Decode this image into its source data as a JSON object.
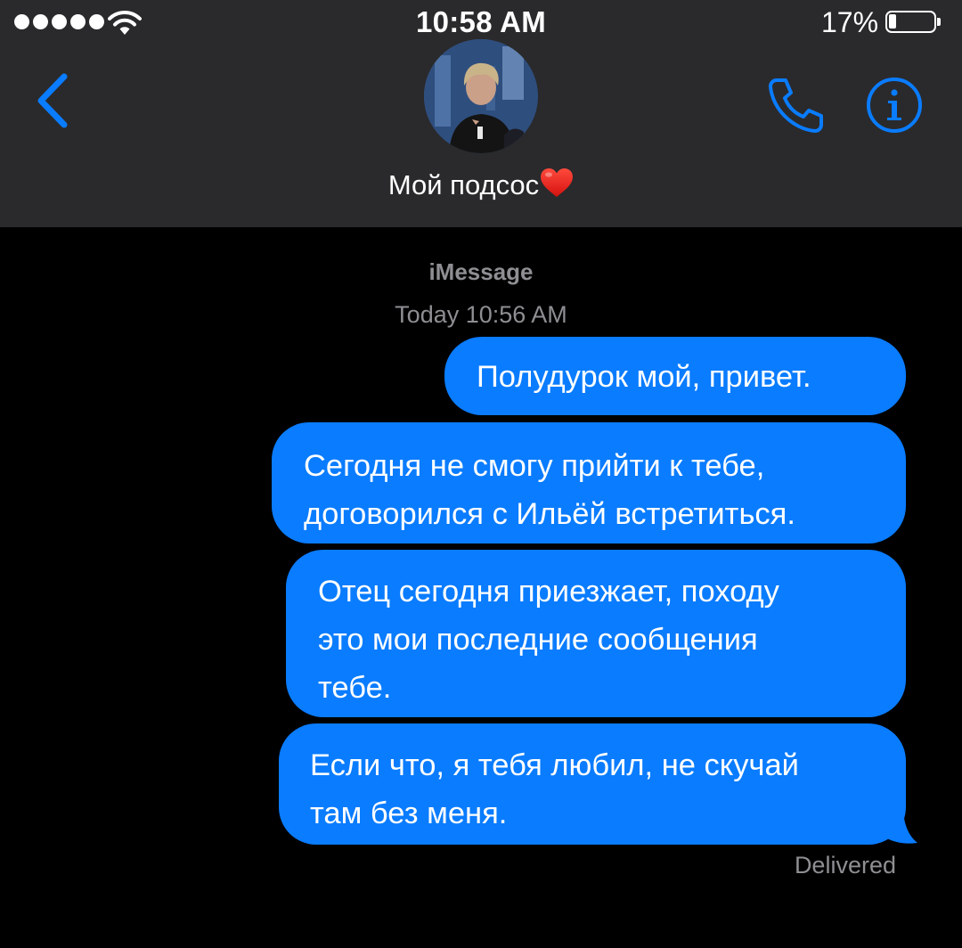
{
  "status_bar": {
    "time": "10:58 AM",
    "battery_percent": "17%",
    "battery_level": 0.17,
    "signal_bars": 5
  },
  "header": {
    "back_icon": "chevron-left-icon",
    "contact_name": "Мой подсос",
    "contact_emoji": "heart-emoji",
    "call_icon": "phone-icon",
    "info_icon": "info-icon"
  },
  "thread": {
    "service": "iMessage",
    "timestamp": "Today 10:56 AM",
    "messages": [
      {
        "text": "Полудурок мой, привет."
      },
      {
        "text": "Сегодня не смогу прийти к тебе,\nдоговорился с Ильёй встретиться."
      },
      {
        "text": "Отец сегодня приезжает, походу\nэто мои последние сообщения\nтебе."
      },
      {
        "text": "Если что, я тебя любил, не скучай\nтам без меня."
      }
    ],
    "status": "Delivered"
  },
  "colors": {
    "accent": "#0a7cff",
    "header_bg": "#2a2a2c",
    "background": "#000000",
    "secondary_text": "#8e8e93"
  }
}
